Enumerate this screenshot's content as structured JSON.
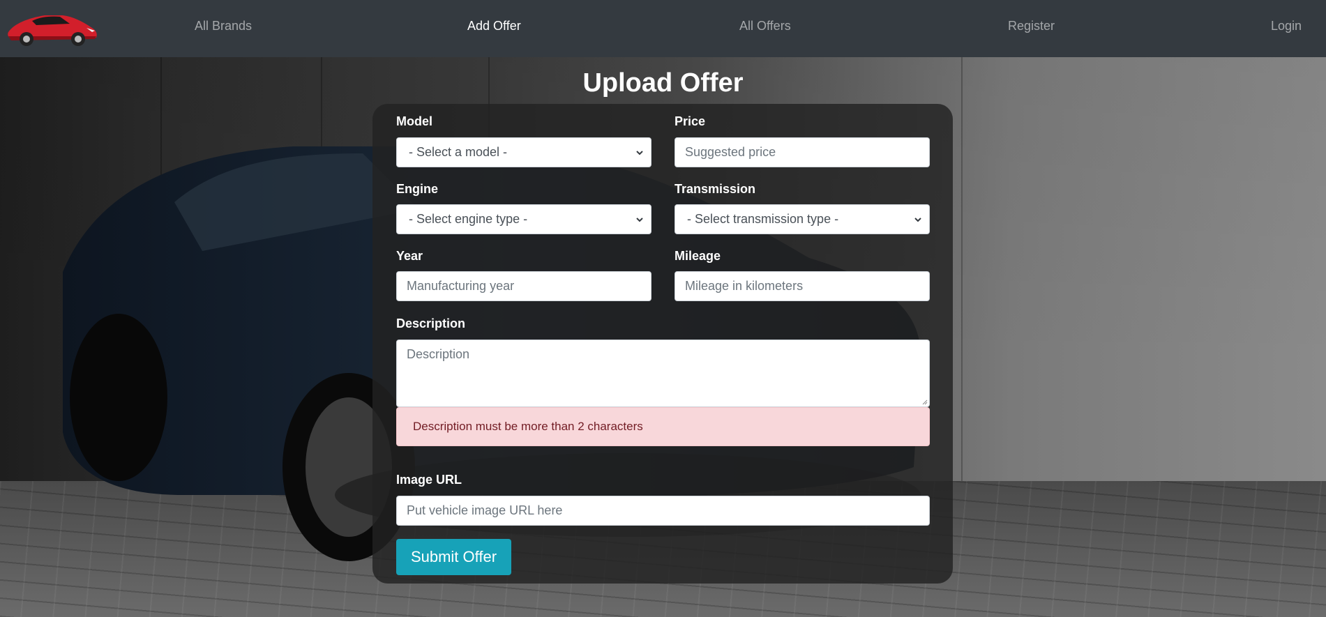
{
  "nav": {
    "items": [
      {
        "label": "All Brands",
        "active": false
      },
      {
        "label": "Add Offer",
        "active": true
      },
      {
        "label": "All Offers",
        "active": false
      },
      {
        "label": "Register",
        "active": false
      },
      {
        "label": "Login",
        "active": false
      }
    ],
    "logo_icon": "red-sports-car-icon"
  },
  "page": {
    "title": "Upload Offer"
  },
  "form": {
    "model": {
      "label": "Model",
      "selected": "- Select a model -"
    },
    "price": {
      "label": "Price",
      "placeholder": "Suggested price"
    },
    "engine": {
      "label": "Engine",
      "selected": "- Select engine type -"
    },
    "transmission": {
      "label": "Transmission",
      "selected": "- Select transmission type -"
    },
    "year": {
      "label": "Year",
      "placeholder": "Manufacturing year"
    },
    "mileage": {
      "label": "Mileage",
      "placeholder": "Mileage in kilometers"
    },
    "description": {
      "label": "Description",
      "placeholder": "Description",
      "error": "Description must be more than 2 characters"
    },
    "image_url": {
      "label": "Image URL",
      "placeholder": "Put vehicle image URL here"
    },
    "submit_label": "Submit Offer"
  },
  "colors": {
    "navbar": "#343a40",
    "accent": "#17a2b8",
    "alert_bg": "#f8d7da",
    "alert_text": "#721c24"
  }
}
